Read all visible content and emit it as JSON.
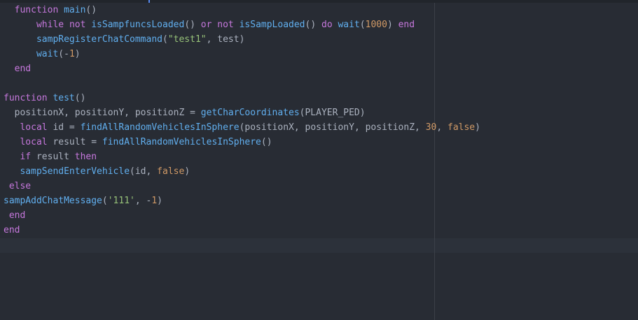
{
  "colors": {
    "background": "#282c34",
    "keyword": "#c678dd",
    "function": "#61afef",
    "string": "#98c379",
    "number": "#d19a66",
    "plain": "#abb2bf",
    "cursor_line": "#2c313a"
  },
  "code": {
    "lines": [
      [
        {
          "t": "  "
        },
        {
          "t": "function",
          "c": "kw"
        },
        {
          "t": " "
        },
        {
          "t": "main",
          "c": "fn"
        },
        {
          "t": "()"
        }
      ],
      [
        {
          "t": "      "
        },
        {
          "t": "while",
          "c": "kw"
        },
        {
          "t": " "
        },
        {
          "t": "not",
          "c": "kw"
        },
        {
          "t": " "
        },
        {
          "t": "isSampfuncsLoaded",
          "c": "fn"
        },
        {
          "t": "() "
        },
        {
          "t": "or",
          "c": "kw"
        },
        {
          "t": " "
        },
        {
          "t": "not",
          "c": "kw"
        },
        {
          "t": " "
        },
        {
          "t": "isSampLoaded",
          "c": "fn"
        },
        {
          "t": "() "
        },
        {
          "t": "do",
          "c": "kw"
        },
        {
          "t": " "
        },
        {
          "t": "wait",
          "c": "fn"
        },
        {
          "t": "("
        },
        {
          "t": "1000",
          "c": "num"
        },
        {
          "t": ") "
        },
        {
          "t": "end",
          "c": "kw"
        }
      ],
      [
        {
          "t": "      "
        },
        {
          "t": "sampRegisterChatCommand",
          "c": "fn"
        },
        {
          "t": "("
        },
        {
          "t": "\"test1\"",
          "c": "str"
        },
        {
          "t": ", test)"
        }
      ],
      [
        {
          "t": "      "
        },
        {
          "t": "wait",
          "c": "fn"
        },
        {
          "t": "(-"
        },
        {
          "t": "1",
          "c": "num"
        },
        {
          "t": ")"
        }
      ],
      [
        {
          "t": "  "
        },
        {
          "t": "end",
          "c": "kw"
        }
      ],
      [
        {
          "t": ""
        }
      ],
      [
        {
          "t": "function",
          "c": "kw"
        },
        {
          "t": " "
        },
        {
          "t": "test",
          "c": "fn"
        },
        {
          "t": "()"
        }
      ],
      [
        {
          "t": "  positionX, positionY, positionZ = "
        },
        {
          "t": "getCharCoordinates",
          "c": "fn"
        },
        {
          "t": "(PLAYER_PED)"
        }
      ],
      [
        {
          "t": "   "
        },
        {
          "t": "local",
          "c": "kw"
        },
        {
          "t": " id = "
        },
        {
          "t": "findAllRandomVehiclesInSphere",
          "c": "fn"
        },
        {
          "t": "(positionX, positionY, positionZ, "
        },
        {
          "t": "30",
          "c": "num"
        },
        {
          "t": ", "
        },
        {
          "t": "false",
          "c": "bool"
        },
        {
          "t": ")"
        }
      ],
      [
        {
          "t": "   "
        },
        {
          "t": "local",
          "c": "kw"
        },
        {
          "t": " result = "
        },
        {
          "t": "findAllRandomVehiclesInSphere",
          "c": "fn"
        },
        {
          "t": "()"
        }
      ],
      [
        {
          "t": "   "
        },
        {
          "t": "if",
          "c": "kw"
        },
        {
          "t": " result "
        },
        {
          "t": "then",
          "c": "kw"
        }
      ],
      [
        {
          "t": "   "
        },
        {
          "t": "sampSendEnterVehicle",
          "c": "fn"
        },
        {
          "t": "(id, "
        },
        {
          "t": "false",
          "c": "bool"
        },
        {
          "t": ")"
        }
      ],
      [
        {
          "t": " "
        },
        {
          "t": "else",
          "c": "kw"
        }
      ],
      [
        {
          "t": "sampAddChatMessage",
          "c": "fn"
        },
        {
          "t": "("
        },
        {
          "t": "'111'",
          "c": "str"
        },
        {
          "t": ", -"
        },
        {
          "t": "1",
          "c": "num"
        },
        {
          "t": ")"
        }
      ],
      [
        {
          "t": " "
        },
        {
          "t": "end",
          "c": "kw"
        }
      ],
      [
        {
          "t": "end",
          "c": "kw"
        }
      ],
      [
        {
          "t": ""
        }
      ]
    ]
  }
}
